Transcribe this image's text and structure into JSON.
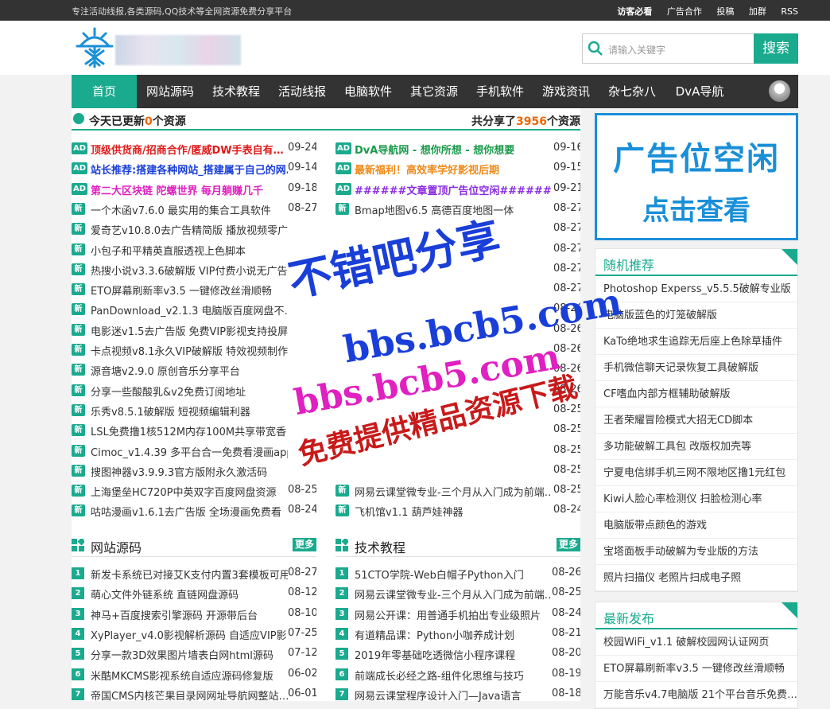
{
  "topbar": {
    "tagline": "专注活动线报,各类源码,QQ技术等全网资源免费分享平台",
    "links": [
      "访客必看",
      "广告合作",
      "投稿",
      "加群",
      "RSS"
    ]
  },
  "search": {
    "placeholder": "请输入关键字",
    "button": "搜索"
  },
  "nav": {
    "items": [
      "首页",
      "网站源码",
      "技术教程",
      "活动线报",
      "电脑软件",
      "其它资源",
      "手机软件",
      "游戏资讯",
      "杂七杂八",
      "DvA导航"
    ]
  },
  "updates": {
    "left_pre": "今天已更新",
    "left_num": "0",
    "left_post": "个资源",
    "right_pre": "共分享了",
    "right_num": "3956",
    "right_post": "个资源"
  },
  "colors": {
    "accent": "#1aaa8e",
    "ad_red": "#e01a1a",
    "ad_blue": "#1a3fd8",
    "ad_pink": "#e020c0",
    "ad_green": "#1a9a4a",
    "ad_orange": "#f08a1a",
    "ad_purple": "#8a2be2"
  },
  "latest_left": [
    {
      "badge": "AD",
      "text": "顶级供货商/招商合作/匿威DW手表自有…",
      "date": "09-24",
      "color": "#e01a1a"
    },
    {
      "badge": "AD",
      "text": "站长推荐:搭建各种网站_搭建属于自己的网…",
      "date": "09-14",
      "color": "#1a3fd8"
    },
    {
      "badge": "AD",
      "text": "第二大区块链 陀螺世界 每月躺赚几千",
      "date": "09-18",
      "color": "#e020c0"
    },
    {
      "badge": "新",
      "text": "一个木函v7.6.0 最实用的集合工具软件",
      "date": "08-27",
      "color": "#333"
    },
    {
      "badge": "新",
      "text": "爱奇艺v10.8.0去广告精简版 播放视频零广",
      "date": "",
      "color": "#333"
    },
    {
      "badge": "新",
      "text": "小包子和平精英直服透视上色脚本",
      "date": "",
      "color": "#333"
    },
    {
      "badge": "新",
      "text": "热搜小说v3.3.6破解版 VIP付费小说无广告",
      "date": "",
      "color": "#333"
    },
    {
      "badge": "新",
      "text": "ETO屏幕刷新率v3.5 一键修改丝滑顺畅",
      "date": "",
      "color": "#333"
    },
    {
      "badge": "新",
      "text": "PanDownload_v2.1.3 电脑版百度网盘不…",
      "date": "",
      "color": "#333"
    },
    {
      "badge": "新",
      "text": "电影迷v1.5去广告版 免费VIP影视支持投屏",
      "date": "",
      "color": "#333"
    },
    {
      "badge": "新",
      "text": "卡点视频v8.1永久VIP破解版 特效视频制作",
      "date": "",
      "color": "#333"
    },
    {
      "badge": "新",
      "text": "源音塘v2.9.0 原创音乐分享平台",
      "date": "",
      "color": "#333"
    },
    {
      "badge": "新",
      "text": "分享一些酸酸乳&v2免费订阅地址",
      "date": "",
      "color": "#333"
    },
    {
      "badge": "新",
      "text": "乐秀v8.5.1破解版 短视频编辑利器",
      "date": "",
      "color": "#333"
    },
    {
      "badge": "新",
      "text": "LSL免费撸1核512M内存100M共享带宽香",
      "date": "",
      "color": "#333"
    },
    {
      "badge": "新",
      "text": "Cimoc_v1.4.39 多平台合一免费看漫画app",
      "date": "",
      "color": "#333"
    },
    {
      "badge": "新",
      "text": "搜图神器v3.9.9.3官方版附永久激活码",
      "date": "",
      "color": "#333"
    },
    {
      "badge": "新",
      "text": "上海堡垒HC720P中英双字百度网盘资源",
      "date": "08-25",
      "color": "#333"
    },
    {
      "badge": "新",
      "text": "咕咕漫画v1.6.1去广告版 全场漫画免费看",
      "date": "08-24",
      "color": "#333"
    }
  ],
  "latest_right": [
    {
      "badge": "AD",
      "text": "DvA导航网 - 想你所想 - 想你想要",
      "date": "09-16",
      "color": "#1a9a4a"
    },
    {
      "badge": "AD",
      "text": "最新福利！高效率学好影视后期",
      "date": "09-15",
      "color": "#f08a1a"
    },
    {
      "badge": "AD",
      "text": "######文章置顶广告位空闲######",
      "date": "09-21",
      "color": "#8a2be2"
    },
    {
      "badge": "新",
      "text": "Bmap地图v6.5 高德百度地图一体",
      "date": "08-27",
      "color": "#333"
    },
    {
      "badge": "",
      "text": "",
      "date": "08-27",
      "color": "#333"
    },
    {
      "badge": "",
      "text": "",
      "date": "08-27",
      "color": "#333"
    },
    {
      "badge": "",
      "text": "",
      "date": "08-27",
      "color": "#333"
    },
    {
      "badge": "",
      "text": "",
      "date": "08-27",
      "color": "#333"
    },
    {
      "badge": "",
      "text": "",
      "date": "08-26",
      "color": "#333"
    },
    {
      "badge": "",
      "text": "",
      "date": "08-26",
      "color": "#333"
    },
    {
      "badge": "",
      "text": "",
      "date": "08-26",
      "color": "#333"
    },
    {
      "badge": "",
      "text": "",
      "date": "08-26",
      "color": "#333"
    },
    {
      "badge": "",
      "text": "",
      "date": "08-26",
      "color": "#333"
    },
    {
      "badge": "",
      "text": "",
      "date": "08-25",
      "color": "#333"
    },
    {
      "badge": "",
      "text": "",
      "date": "08-25",
      "color": "#333"
    },
    {
      "badge": "",
      "text": "",
      "date": "08-25",
      "color": "#333"
    },
    {
      "badge": "",
      "text": "",
      "date": "08-25",
      "color": "#333"
    },
    {
      "badge": "新",
      "text": "网易云课堂微专业-三个月从入门成为前端…",
      "date": "08-25",
      "color": "#333"
    },
    {
      "badge": "新",
      "text": "飞机馆v1.1 葫芦娃神器",
      "date": "08-24",
      "color": "#333"
    }
  ],
  "sections": [
    {
      "title": "网站源码",
      "more": "更多",
      "items": [
        {
          "n": "1",
          "text": "新发卡系统已对接艾K支付内置3套模板可用",
          "date": "08-27"
        },
        {
          "n": "2",
          "text": "萌心文件外链系统 直链网盘源码",
          "date": "08-12"
        },
        {
          "n": "3",
          "text": "神马+百度搜索引擎源码 开源带后台",
          "date": "08-10"
        },
        {
          "n": "4",
          "text": "XyPlayer_v4.0影视解析源码 自适应VIP影…",
          "date": "07-25"
        },
        {
          "n": "5",
          "text": "分享一款3D效果图片墙表白网html源码",
          "date": "07-12"
        },
        {
          "n": "6",
          "text": "米酷MKCMS影视系统自适应源码修复版",
          "date": "06-02"
        },
        {
          "n": "7",
          "text": "帝国CMS内核芒果目录网网址导航网整站…",
          "date": "06-01"
        }
      ]
    },
    {
      "title": "技术教程",
      "more": "更多",
      "items": [
        {
          "n": "1",
          "text": "51CTO学院-Web白帽子Python入门",
          "date": "08-26"
        },
        {
          "n": "2",
          "text": "网易云课堂微专业-三个月从入门成为前端…",
          "date": "08-25"
        },
        {
          "n": "3",
          "text": "网易公开课：用普通手机拍出专业级照片",
          "date": "08-24"
        },
        {
          "n": "4",
          "text": "有道精品课：Python小咖养成计划",
          "date": "08-21"
        },
        {
          "n": "5",
          "text": "2019年零基础吃透微信小程序课程",
          "date": "08-20"
        },
        {
          "n": "6",
          "text": "前端成长必经之路-组件化思维与技巧",
          "date": "08-19"
        },
        {
          "n": "7",
          "text": "网易云课堂程序设计入门—Java语言",
          "date": "08-18"
        }
      ]
    }
  ],
  "ad": {
    "line1": "广告位空闲",
    "line2": "点击查看"
  },
  "random": {
    "title": "随机推荐",
    "items": [
      "Photoshop Experss_v5.5.5破解专业版",
      "电脑版蓝色的灯笼破解版",
      "KaTo绝地求生追踪无后座上色除草插件",
      "手机微信聊天记录恢复工具破解版",
      "CF嗜血内部方框辅助破解版",
      "王者荣耀冒险模式大招无CD脚本",
      "多功能破解工具包 改版权加壳等",
      "宁夏电信绑手机三网不限地区撸1元红包",
      "Kiwi人脸心率检测仪 扫脸检测心率",
      "电脑版带点颜色的游戏",
      "宝塔面板手动破解为专业版的方法",
      "照片扫描仪 老照片扫成电子照"
    ]
  },
  "newest": {
    "title": "最新发布",
    "items": [
      "校园WiFi_v1.1 破解校园网认证网页",
      "ETO屏幕刷新率v3.5 一键修改丝滑顺畅",
      "万能音乐v4.7电脑版 21个平台音乐免费…"
    ]
  },
  "watermark": {
    "line1": "不错吧分享",
    "line2": "bbs.bcb5.com",
    "line3": "免费提供精品资源下载"
  }
}
